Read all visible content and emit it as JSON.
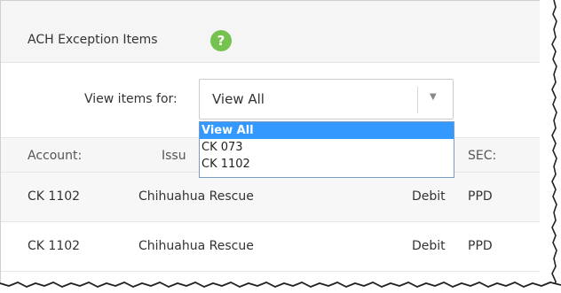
{
  "panel": {
    "title": "ACH Exception Items",
    "help_icon_glyph": "?",
    "help_icon_color": "#76c24f"
  },
  "filter": {
    "label": "View items for:",
    "selected_value": "View All",
    "arrow_glyph": "▼",
    "options": [
      "View All",
      "CK 073",
      "CK 1102"
    ]
  },
  "table": {
    "headers": {
      "account": "Account:",
      "issuer": "Issu",
      "sec": "SEC:"
    },
    "rows": [
      {
        "account": "CK 1102",
        "issuer": "Chihuahua Rescue",
        "type": "Debit",
        "sec": "PPD"
      },
      {
        "account": "CK 1102",
        "issuer": "Chihuahua Rescue",
        "type": "Debit",
        "sec": "PPD"
      }
    ]
  },
  "colors": {
    "selection": "#3399ff",
    "header_bg": "#f5f5f5"
  }
}
